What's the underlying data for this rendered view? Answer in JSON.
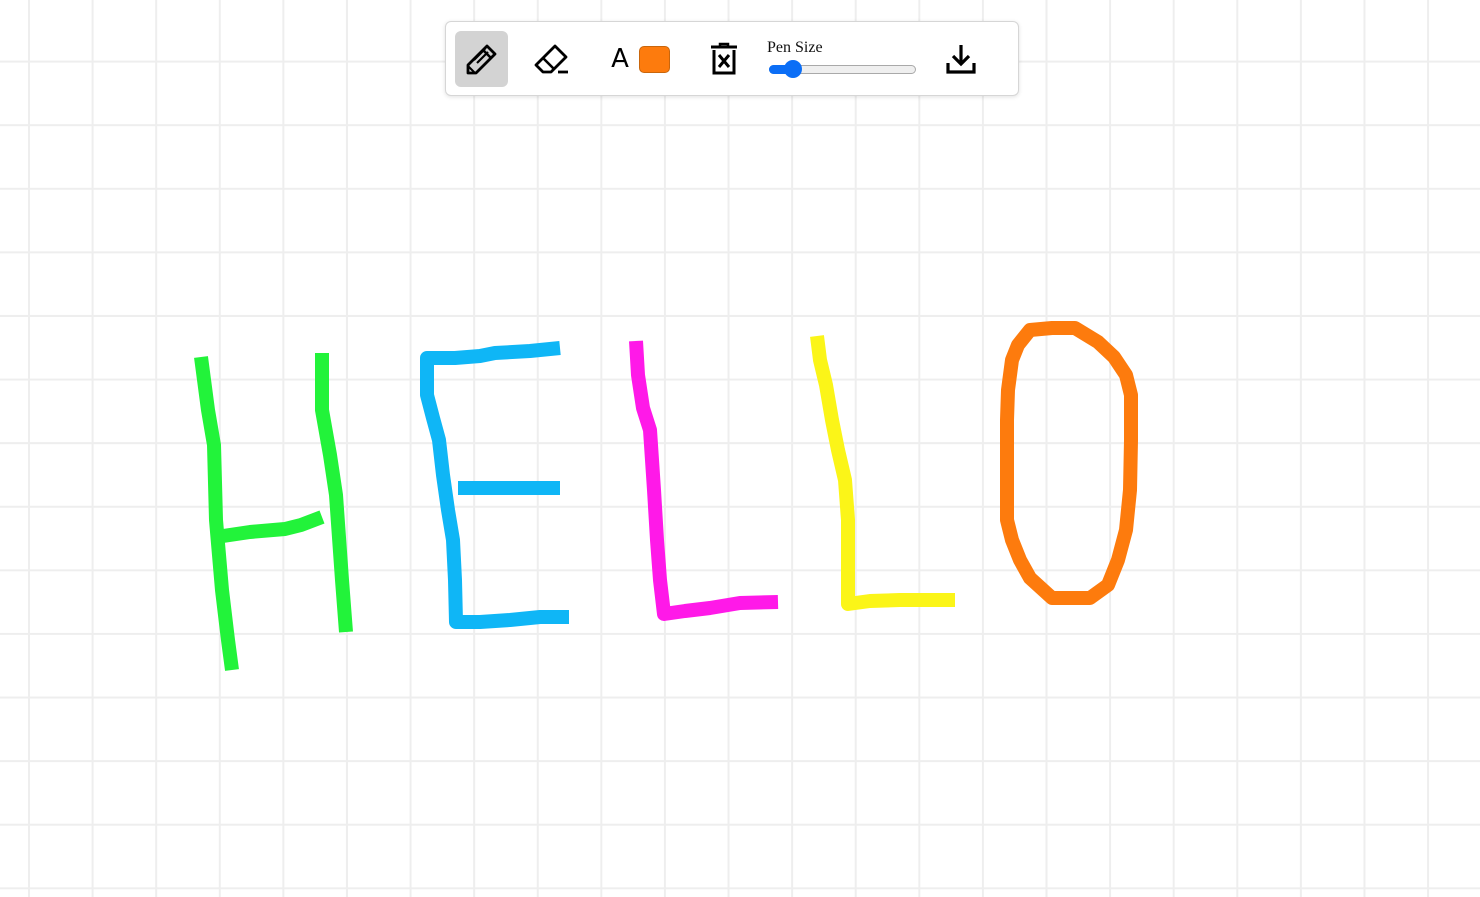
{
  "toolbar": {
    "tools": {
      "pen": {
        "icon": "pencil-icon",
        "active": true
      },
      "eraser": {
        "icon": "eraser-icon"
      },
      "text": {
        "label": "A"
      },
      "clear": {
        "icon": "delete-canvas-icon"
      },
      "download": {
        "icon": "download-icon"
      }
    },
    "color": {
      "value": "#fd7b0d"
    },
    "pen_size": {
      "label": "Pen Size",
      "value_fraction": 0.11
    }
  },
  "canvas": {
    "background": "#ffffff",
    "grid_color": "#eeeeee",
    "drawing_letters": [
      {
        "letter": "H",
        "color": "#22f33a"
      },
      {
        "letter": "E",
        "color": "#0fb6f6"
      },
      {
        "letter": "L",
        "color": "#ff19e8"
      },
      {
        "letter": "L",
        "color": "#fbf518"
      },
      {
        "letter": "O",
        "color": "#fd7b0d"
      }
    ]
  }
}
